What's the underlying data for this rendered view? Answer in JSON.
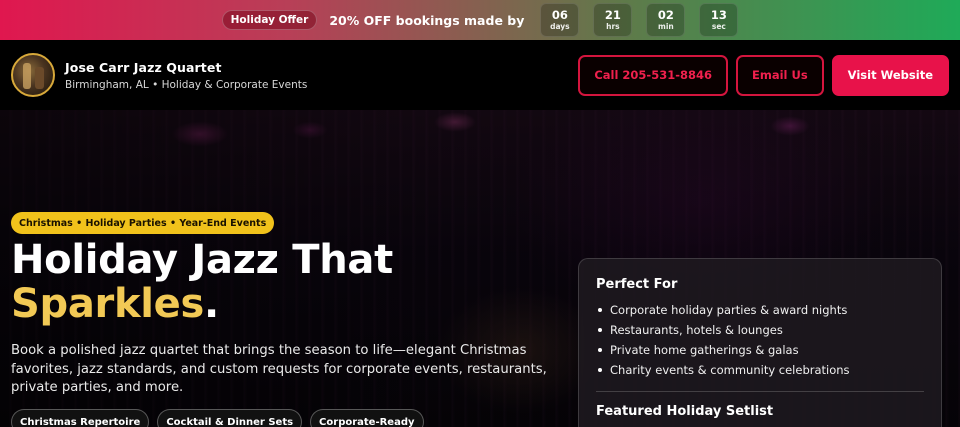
{
  "promo": {
    "badge": "Holiday Offer",
    "text": "20% OFF bookings made by",
    "countdown": [
      {
        "value": "06",
        "unit": "days"
      },
      {
        "value": "21",
        "unit": "hrs"
      },
      {
        "value": "02",
        "unit": "min"
      },
      {
        "value": "13",
        "unit": "sec"
      }
    ]
  },
  "header": {
    "name": "Jose Carr Jazz Quartet",
    "subtitle": "Birmingham, AL • Holiday & Corporate Events",
    "call_label": "Call 205-531-8846",
    "email_label": "Email Us",
    "website_label": "Visit Website"
  },
  "hero": {
    "tag": "Christmas • Holiday Parties • Year-End Events",
    "title_line1": "Holiday Jazz That",
    "title_accent": "Sparkles",
    "title_end": ".",
    "lead": "Book a polished jazz quartet that brings the season to life—elegant Christmas favorites, jazz standards, and custom requests for corporate events, restaurants, private parties, and more.",
    "chips": [
      "Christmas Repertoire",
      "Cocktail & Dinner Sets",
      "Corporate-Ready"
    ]
  },
  "card": {
    "heading": "Perfect For",
    "items": [
      "Corporate holiday parties & award nights",
      "Restaurants, hotels & lounges",
      "Private home gatherings & galas",
      "Charity events & community celebrations"
    ],
    "heading2": "Featured Holiday Setlist"
  },
  "colors": {
    "brand_red": "#e8124a",
    "accent_gold": "#f2c955",
    "promo_green": "#1faa58"
  }
}
